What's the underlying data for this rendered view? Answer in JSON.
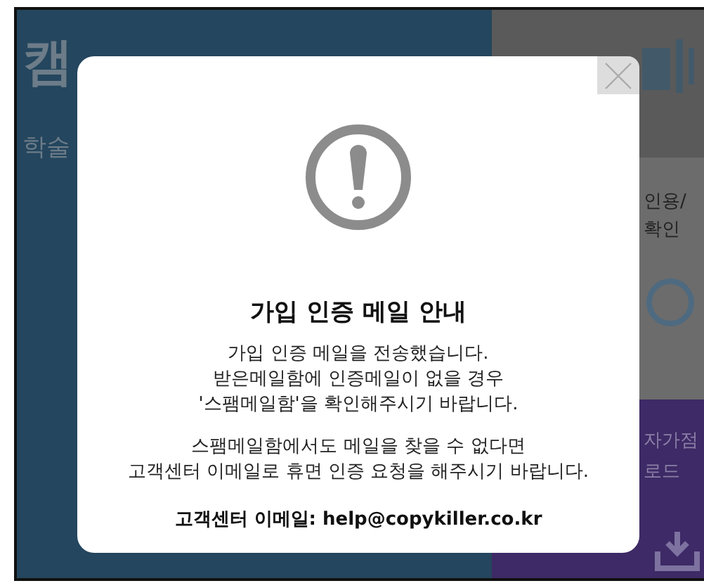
{
  "background": {
    "logo_text": "캠",
    "left_text": "학술",
    "right_top_texts": [
      "인용/",
      "확인"
    ],
    "right_bottom_texts": [
      "자가점",
      "로드"
    ]
  },
  "dialog": {
    "title": "가입 인증 메일 안내",
    "paragraphs": [
      "가입 인증 메일을 전송했습니다.\n받은메일함에 인증메일이 없을 경우\n'스팸메일함'을 확인해주시기 바랍니다.",
      "스팸메일함에서도 메일을 찾을 수 없다면\n고객센터 이메일로 휴면 인증 요청을 해주시기 바랍니다."
    ],
    "contact": "고객센터 이메일: help@copykiller.co.kr"
  }
}
